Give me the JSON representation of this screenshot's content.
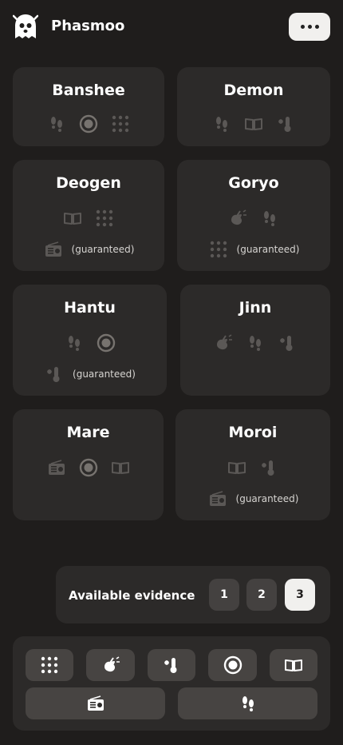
{
  "app": {
    "title": "Phasmoo",
    "logo_icon": "ghost-icon",
    "menu_icon": "more-horizontal-icon"
  },
  "ghosts": [
    {
      "name": "Banshee",
      "evidence": [
        "footprints",
        "ghost-orb",
        "dots-projector"
      ],
      "guaranteed": null
    },
    {
      "name": "Demon",
      "evidence": [
        "footprints",
        "ghost-writing",
        "freezing-temps"
      ],
      "guaranteed": null
    },
    {
      "name": "Deogen",
      "evidence": [
        "ghost-writing",
        "dots-projector"
      ],
      "guaranteed": {
        "evidence": "spirit-box",
        "label": "(guaranteed)"
      }
    },
    {
      "name": "Goryo",
      "evidence": [
        "emf",
        "footprints"
      ],
      "guaranteed": {
        "evidence": "dots-projector",
        "label": "(guaranteed)"
      }
    },
    {
      "name": "Hantu",
      "evidence": [
        "footprints",
        "ghost-orb"
      ],
      "guaranteed": {
        "evidence": "freezing-temps",
        "label": "(guaranteed)"
      }
    },
    {
      "name": "Jinn",
      "evidence": [
        "emf",
        "footprints",
        "freezing-temps"
      ],
      "guaranteed": null
    },
    {
      "name": "Mare",
      "evidence": [
        "spirit-box",
        "ghost-orb",
        "ghost-writing"
      ],
      "guaranteed": null
    },
    {
      "name": "Moroi",
      "evidence": [
        "ghost-writing",
        "freezing-temps"
      ],
      "guaranteed": {
        "evidence": "spirit-box",
        "label": "(guaranteed)"
      }
    }
  ],
  "available": {
    "label": "Available evidence",
    "options": [
      "1",
      "2",
      "3"
    ],
    "selected": "3"
  },
  "filters": [
    "dots-projector",
    "emf",
    "freezing-temps",
    "ghost-orb",
    "ghost-writing",
    "spirit-box",
    "footprints"
  ],
  "colors": {
    "background": "#1f1d1c",
    "card": "#2c2a29",
    "button": "#474442",
    "selected": "#f1f0ee",
    "icon_dim": "#5b5856"
  }
}
